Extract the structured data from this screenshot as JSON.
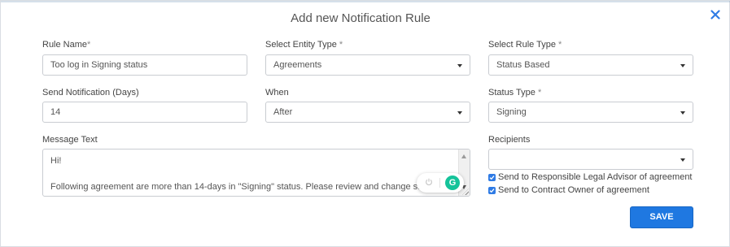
{
  "dialog": {
    "title": "Add new Notification Rule"
  },
  "form": {
    "rule_name": {
      "label": "Rule Name",
      "required_mark": "*",
      "value": "Too log in Signing status"
    },
    "entity_type": {
      "label": "Select Entity Type",
      "required_mark": "*",
      "value": "Agreements"
    },
    "rule_type": {
      "label": "Select Rule Type",
      "required_mark": "*",
      "value": "Status Based"
    },
    "send_days": {
      "label": "Send Notification (Days)",
      "value": "14"
    },
    "when": {
      "label": "When",
      "value": "After"
    },
    "status_type": {
      "label": "Status Type",
      "required_mark": "*",
      "value": "Signing"
    },
    "message": {
      "label": "Message Text",
      "line1": "Hi!",
      "line2": "Following agreement are more than 14-days in \"Signing\" status. Please review and change sta..."
    },
    "recipients": {
      "label": "Recipients",
      "value": ""
    },
    "checkboxes": [
      {
        "label": "Send to Responsible Legal Advisor of agreement",
        "checked": true
      },
      {
        "label": "Send to Contract Owner of agreement",
        "checked": true
      }
    ]
  },
  "actions": {
    "save_label": "SAVE"
  },
  "icons": {
    "close": "close-icon",
    "dropdown": "chevron-down-icon",
    "grammarly": "grammarly-icon"
  },
  "colors": {
    "accent": "#1f78e1",
    "close": "#2f7be5",
    "grammarly": "#15c39a"
  }
}
